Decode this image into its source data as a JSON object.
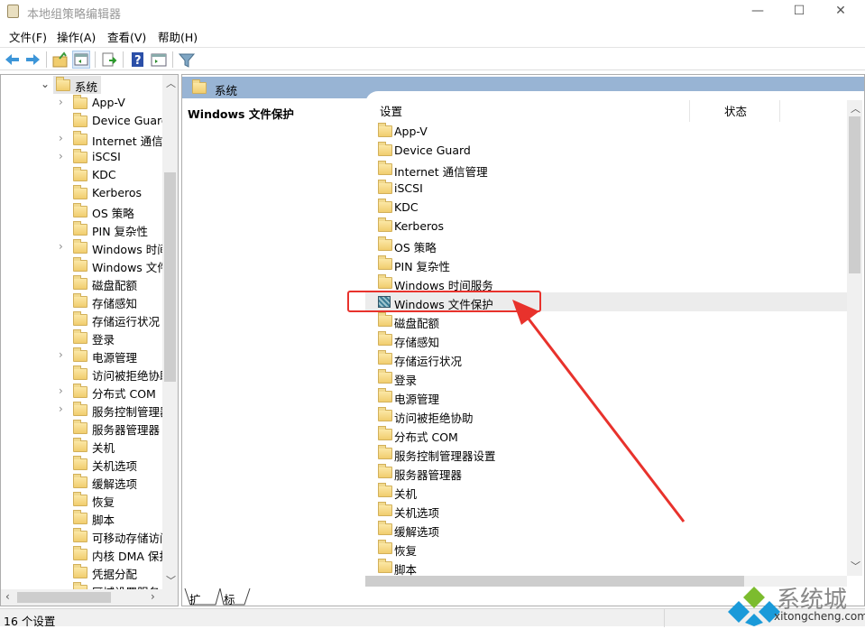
{
  "window": {
    "title": "本地组策略编辑器",
    "minimize": "—",
    "maximize": "☐",
    "close": "✕"
  },
  "menu": [
    "文件(F)",
    "操作(A)",
    "查看(V)",
    "帮助(H)"
  ],
  "toolbar": [
    "back-icon",
    "forward-icon",
    "up-folder-icon",
    "show-hide-tree-icon",
    "export-list-icon",
    "help-icon",
    "properties-icon",
    "filter-icon"
  ],
  "tree": {
    "root": "系统",
    "items": [
      {
        "label": "App-V",
        "expandable": true
      },
      {
        "label": "Device Guard",
        "expandable": false
      },
      {
        "label": "Internet 通信管理",
        "expandable": true
      },
      {
        "label": "iSCSI",
        "expandable": true
      },
      {
        "label": "KDC",
        "expandable": false
      },
      {
        "label": "Kerberos",
        "expandable": false
      },
      {
        "label": "OS 策略",
        "expandable": false
      },
      {
        "label": "PIN 复杂性",
        "expandable": false
      },
      {
        "label": "Windows 时间服务",
        "expandable": true
      },
      {
        "label": "Windows 文件保护",
        "expandable": false
      },
      {
        "label": "磁盘配额",
        "expandable": false
      },
      {
        "label": "存储感知",
        "expandable": false
      },
      {
        "label": "存储运行状况",
        "expandable": false
      },
      {
        "label": "登录",
        "expandable": false
      },
      {
        "label": "电源管理",
        "expandable": true
      },
      {
        "label": "访问被拒绝协助",
        "expandable": false
      },
      {
        "label": "分布式 COM",
        "expandable": true
      },
      {
        "label": "服务控制管理器设置",
        "expandable": true
      },
      {
        "label": "服务器管理器",
        "expandable": false
      },
      {
        "label": "关机",
        "expandable": false
      },
      {
        "label": "关机选项",
        "expandable": false
      },
      {
        "label": "缓解选项",
        "expandable": false
      },
      {
        "label": "恢复",
        "expandable": false
      },
      {
        "label": "脚本",
        "expandable": false
      },
      {
        "label": "可移动存储访问",
        "expandable": false
      },
      {
        "label": "内核 DMA 保护",
        "expandable": false
      },
      {
        "label": "凭据分配",
        "expandable": false
      },
      {
        "label": "区域设置服务",
        "expandable": false
      }
    ]
  },
  "right": {
    "header": "系统",
    "description_title": "Windows 文件保护",
    "columns": [
      "设置",
      "状态"
    ],
    "selected_index": 9,
    "items": [
      "App-V",
      "Device Guard",
      "Internet 通信管理",
      "iSCSI",
      "KDC",
      "Kerberos",
      "OS 策略",
      "PIN 复杂性",
      "Windows 时间服务",
      "Windows 文件保护",
      "磁盘配额",
      "存储感知",
      "存储运行状况",
      "登录",
      "电源管理",
      "访问被拒绝协助",
      "分布式 COM",
      "服务控制管理器设置",
      "服务器管理器",
      "关机",
      "关机选项",
      "缓解选项",
      "恢复",
      "脚本"
    ]
  },
  "tabs": [
    "扩展",
    "标准"
  ],
  "status": "16 个设置",
  "watermark": {
    "name": "系统城",
    "url": "xitongcheng.com"
  },
  "colors": {
    "header": "#98b4d4",
    "annotation": "#e8322c",
    "selected_row": "#ececec"
  }
}
